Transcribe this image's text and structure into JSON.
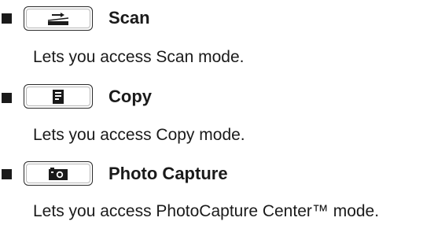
{
  "items": [
    {
      "title": "Scan",
      "description": "Lets you access Scan mode.",
      "icon": "scan-icon"
    },
    {
      "title": "Copy",
      "description": "Lets you access Copy mode.",
      "icon": "copy-icon"
    },
    {
      "title": "Photo Capture",
      "description": "Lets you access PhotoCapture Center™ mode.",
      "icon": "camera-icon"
    }
  ]
}
